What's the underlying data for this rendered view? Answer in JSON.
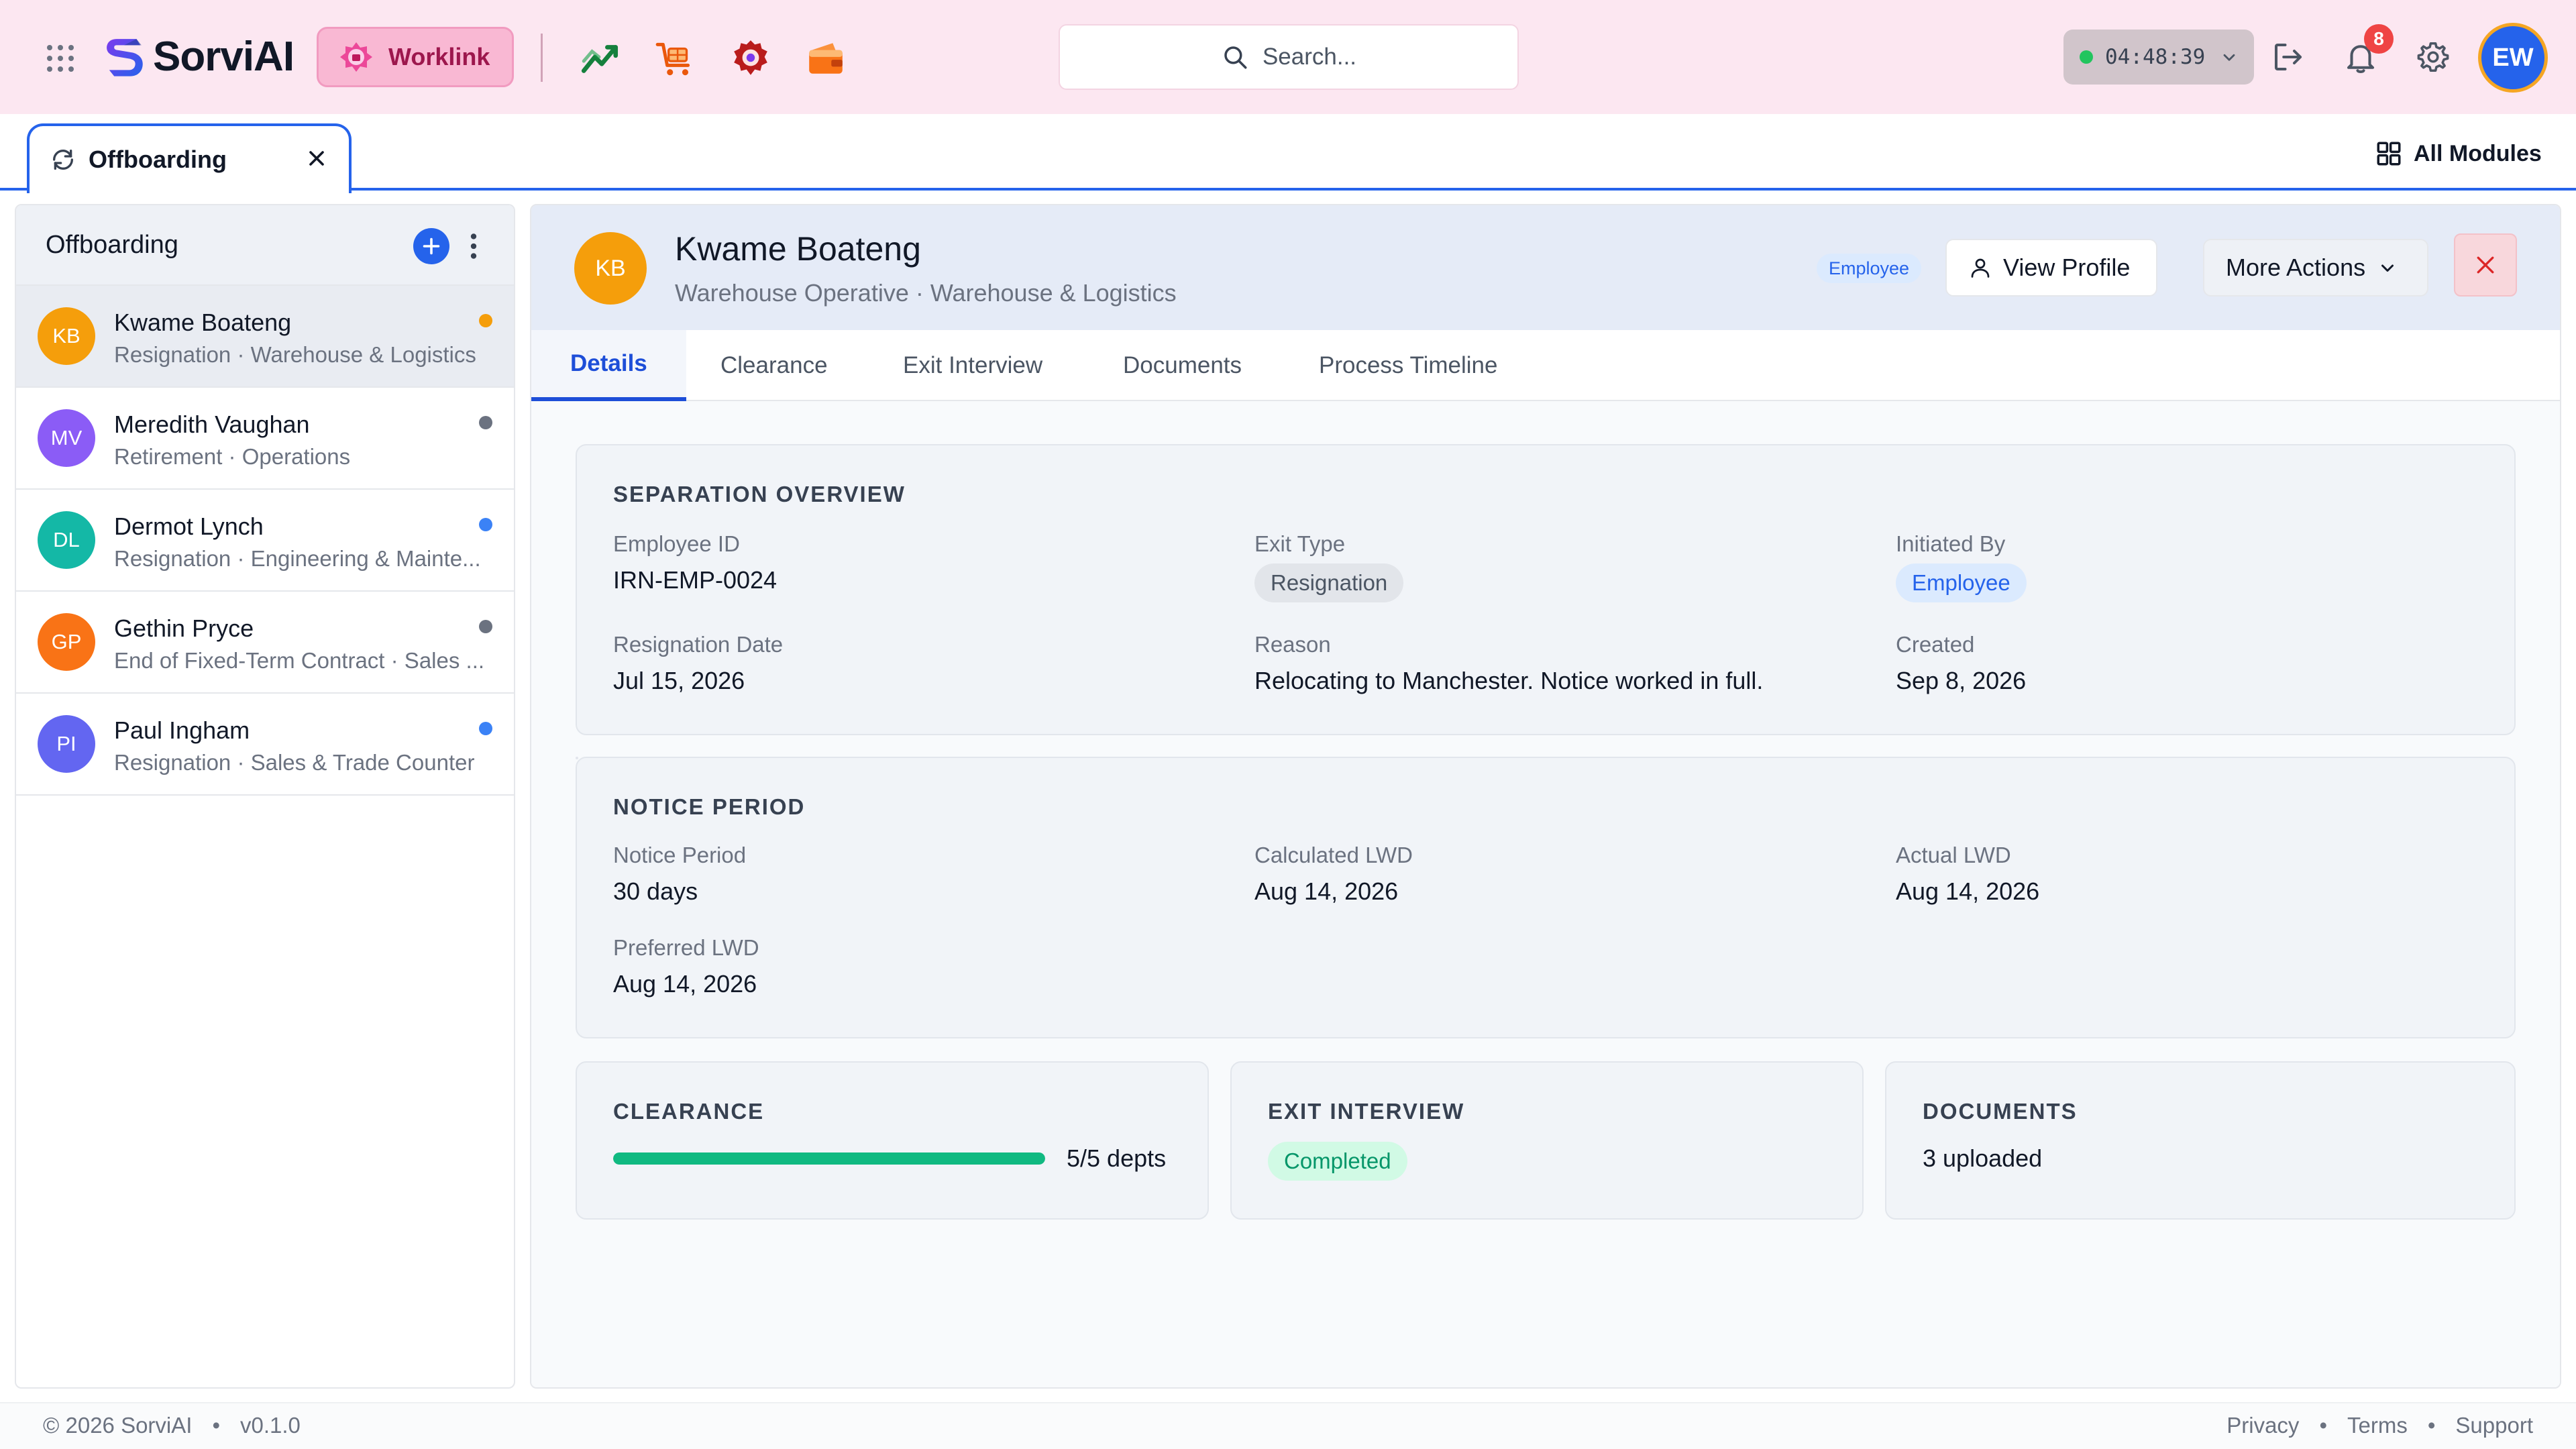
{
  "header": {
    "brand": "SorviAI",
    "active_app": "Worklink",
    "search_placeholder": "Search...",
    "timer": "04:48:39",
    "notifications_count": "8",
    "user_initials": "EW"
  },
  "tabbar": {
    "open_tab": "Offboarding",
    "all_modules": "All Modules"
  },
  "sidebar": {
    "title": "Offboarding",
    "items": [
      {
        "initials": "KB",
        "name": "Kwame Boateng",
        "sub": "Resignation · Warehouse & Logistics",
        "avatar_color": "#f59e0b",
        "dot_color": "#f59e0b"
      },
      {
        "initials": "MV",
        "name": "Meredith Vaughan",
        "sub": "Retirement · Operations",
        "avatar_color": "#8b5cf6",
        "dot_color": "#6b7280"
      },
      {
        "initials": "DL",
        "name": "Dermot Lynch",
        "sub": "Resignation · Engineering & Mainte...",
        "avatar_color": "#14b8a6",
        "dot_color": "#3b82f6"
      },
      {
        "initials": "GP",
        "name": "Gethin Pryce",
        "sub": "End of Fixed-Term Contract · Sales ...",
        "avatar_color": "#f97316",
        "dot_color": "#6b7280"
      },
      {
        "initials": "PI",
        "name": "Paul Ingham",
        "sub": "Resignation · Sales & Trade Counter",
        "avatar_color": "#6366f1",
        "dot_color": "#3b82f6"
      }
    ]
  },
  "detail": {
    "initials": "KB",
    "name": "Kwame Boateng",
    "subtitle": "Warehouse Operative · Warehouse & Logistics",
    "badge": "Employee",
    "view_profile": "View Profile",
    "more_actions": "More Actions",
    "tabs": [
      "Details",
      "Clearance",
      "Exit Interview",
      "Documents",
      "Process Timeline"
    ],
    "separation": {
      "title": "SEPARATION OVERVIEW",
      "employee_id_label": "Employee ID",
      "employee_id": "IRN-EMP-0024",
      "exit_type_label": "Exit Type",
      "exit_type": "Resignation",
      "initiated_by_label": "Initiated By",
      "initiated_by": "Employee",
      "resignation_date_label": "Resignation Date",
      "resignation_date": "Jul 15, 2026",
      "reason_label": "Reason",
      "reason": "Relocating to Manchester. Notice worked in full.",
      "created_label": "Created",
      "created": "Sep 8, 2026"
    },
    "notice": {
      "title": "NOTICE PERIOD",
      "notice_period_label": "Notice Period",
      "notice_period": "30 days",
      "calculated_lwd_label": "Calculated LWD",
      "calculated_lwd": "Aug 14, 2026",
      "actual_lwd_label": "Actual LWD",
      "actual_lwd": "Aug 14, 2026",
      "preferred_lwd_label": "Preferred LWD",
      "preferred_lwd": "Aug 14, 2026"
    },
    "clearance": {
      "title": "CLEARANCE",
      "text": "5/5 depts",
      "progress": 1.0
    },
    "exit_interview": {
      "title": "EXIT INTERVIEW",
      "status": "Completed"
    },
    "documents": {
      "title": "DOCUMENTS",
      "text": "3 uploaded"
    }
  },
  "footer": {
    "copyright": "© 2026 SorviAI",
    "version": "v0.1.0",
    "links": [
      "Privacy",
      "Terms",
      "Support"
    ]
  }
}
